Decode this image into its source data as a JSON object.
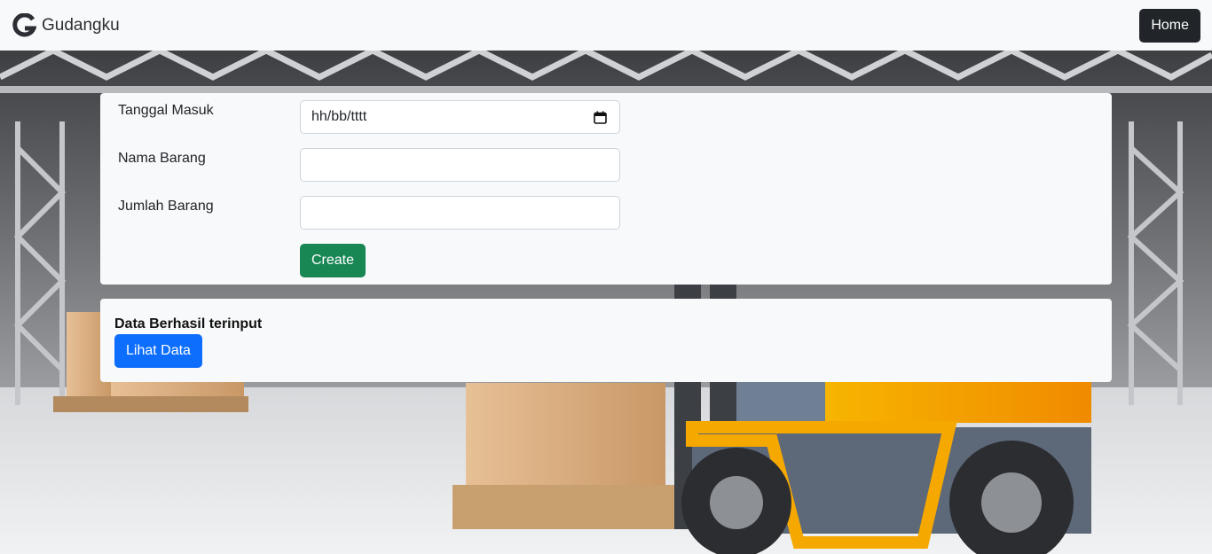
{
  "navbar": {
    "brand": "Gudangku",
    "home_label": "Home"
  },
  "form": {
    "fields": [
      {
        "label": "Tanggal Masuk",
        "value": "hh/bb/tttt",
        "type": "date"
      },
      {
        "label": "Nama Barang",
        "value": "",
        "type": "text"
      },
      {
        "label": "Jumlah Barang",
        "value": "",
        "type": "text"
      }
    ],
    "submit_label": "Create"
  },
  "message": {
    "text": "Data Berhasil terinput",
    "button_label": "Lihat Data"
  },
  "icons": {
    "logo": "g-logo-icon",
    "date": "calendar-icon"
  },
  "colors": {
    "navbar_bg": "#f8f9fa",
    "home_btn": "#212529",
    "create_btn": "#198754",
    "lihat_btn": "#0d6efd",
    "forklift_yellow": "#f5a800"
  }
}
